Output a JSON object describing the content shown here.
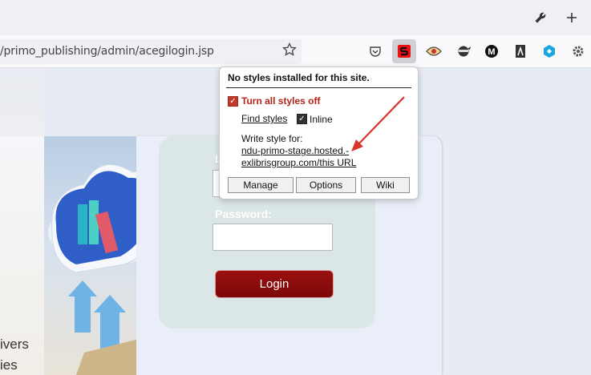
{
  "browser": {
    "url_text": "/primo_publishing/admin/acegilogin.jsp",
    "tab_icons": [
      "wrench-icon",
      "plus-icon"
    ],
    "toolbar_icons": [
      "pocket-icon",
      "stylish-icon",
      "eye-icon",
      "ninja-icon",
      "m-icon",
      "book-icon",
      "hex-icon",
      "gear-icon"
    ]
  },
  "page": {
    "left_text_1": "ivers",
    "left_text_2": "ies",
    "login_label_partial": "L",
    "password_label": "Password:",
    "login_button": "Login"
  },
  "popup": {
    "title": "No styles installed for this site.",
    "turn_off_label": "Turn all styles off",
    "find_styles": "Find styles",
    "inline_label": "Inline",
    "write_style_for": "Write style for:",
    "domain_line1": "ndu-primo-stage.hosted.-",
    "domain_line2": "exlibrisgroup.com/this URL",
    "manage": "Manage",
    "options": "Options",
    "wiki": "Wiki"
  },
  "colors": {
    "accent_red": "#c0392b",
    "login_button": "#8b0c0c",
    "arrow": "#d9342b"
  }
}
